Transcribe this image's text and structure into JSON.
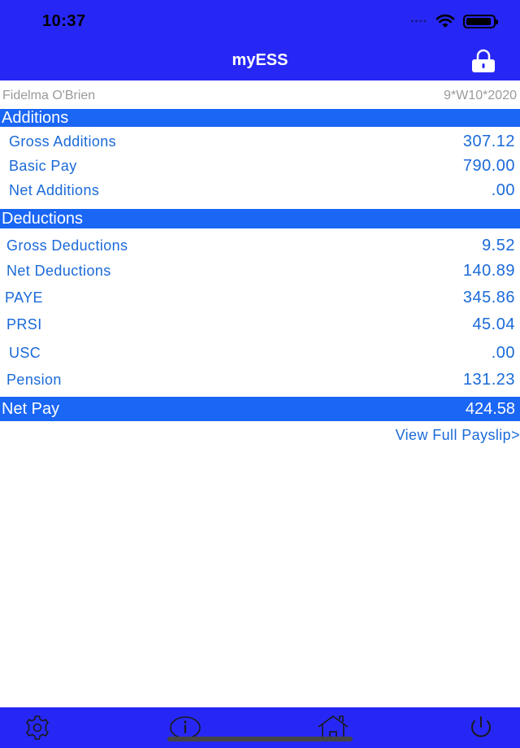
{
  "status_bar": {
    "time": "10:37"
  },
  "nav": {
    "title": "myESS",
    "lock_icon": "lock-icon"
  },
  "employee": {
    "name": "Fidelma O'Brien",
    "period": "9*W10*2020"
  },
  "additions": {
    "header": "Additions",
    "rows": [
      {
        "label": "Gross Additions",
        "value": "307.12"
      },
      {
        "label": "Basic Pay",
        "value": "790.00"
      },
      {
        "label": "Net Additions",
        "value": ".00"
      }
    ]
  },
  "deductions": {
    "header": "Deductions",
    "rows": [
      {
        "label": "Gross Deductions",
        "value": "9.52"
      },
      {
        "label": "Net Deductions",
        "value": "140.89"
      },
      {
        "label": "PAYE",
        "value": "345.86"
      },
      {
        "label": "PRSI",
        "value": "45.04"
      },
      {
        "label": "USC",
        "value": ".00"
      },
      {
        "label": "Pension",
        "value": "131.23"
      }
    ]
  },
  "net_pay": {
    "label": "Net Pay",
    "value": "424.58"
  },
  "view_full_payslip": "View Full Payslip>",
  "tabbar": {
    "items": [
      {
        "icon": "gear-icon"
      },
      {
        "icon": "info-icon"
      },
      {
        "icon": "home-icon"
      },
      {
        "icon": "power-icon"
      }
    ]
  },
  "colors": {
    "nav_bg": "#2727f5",
    "section_bg": "#1a66f5",
    "text_blue": "#1a6ad8",
    "muted_gray": "#9a9a9a"
  }
}
